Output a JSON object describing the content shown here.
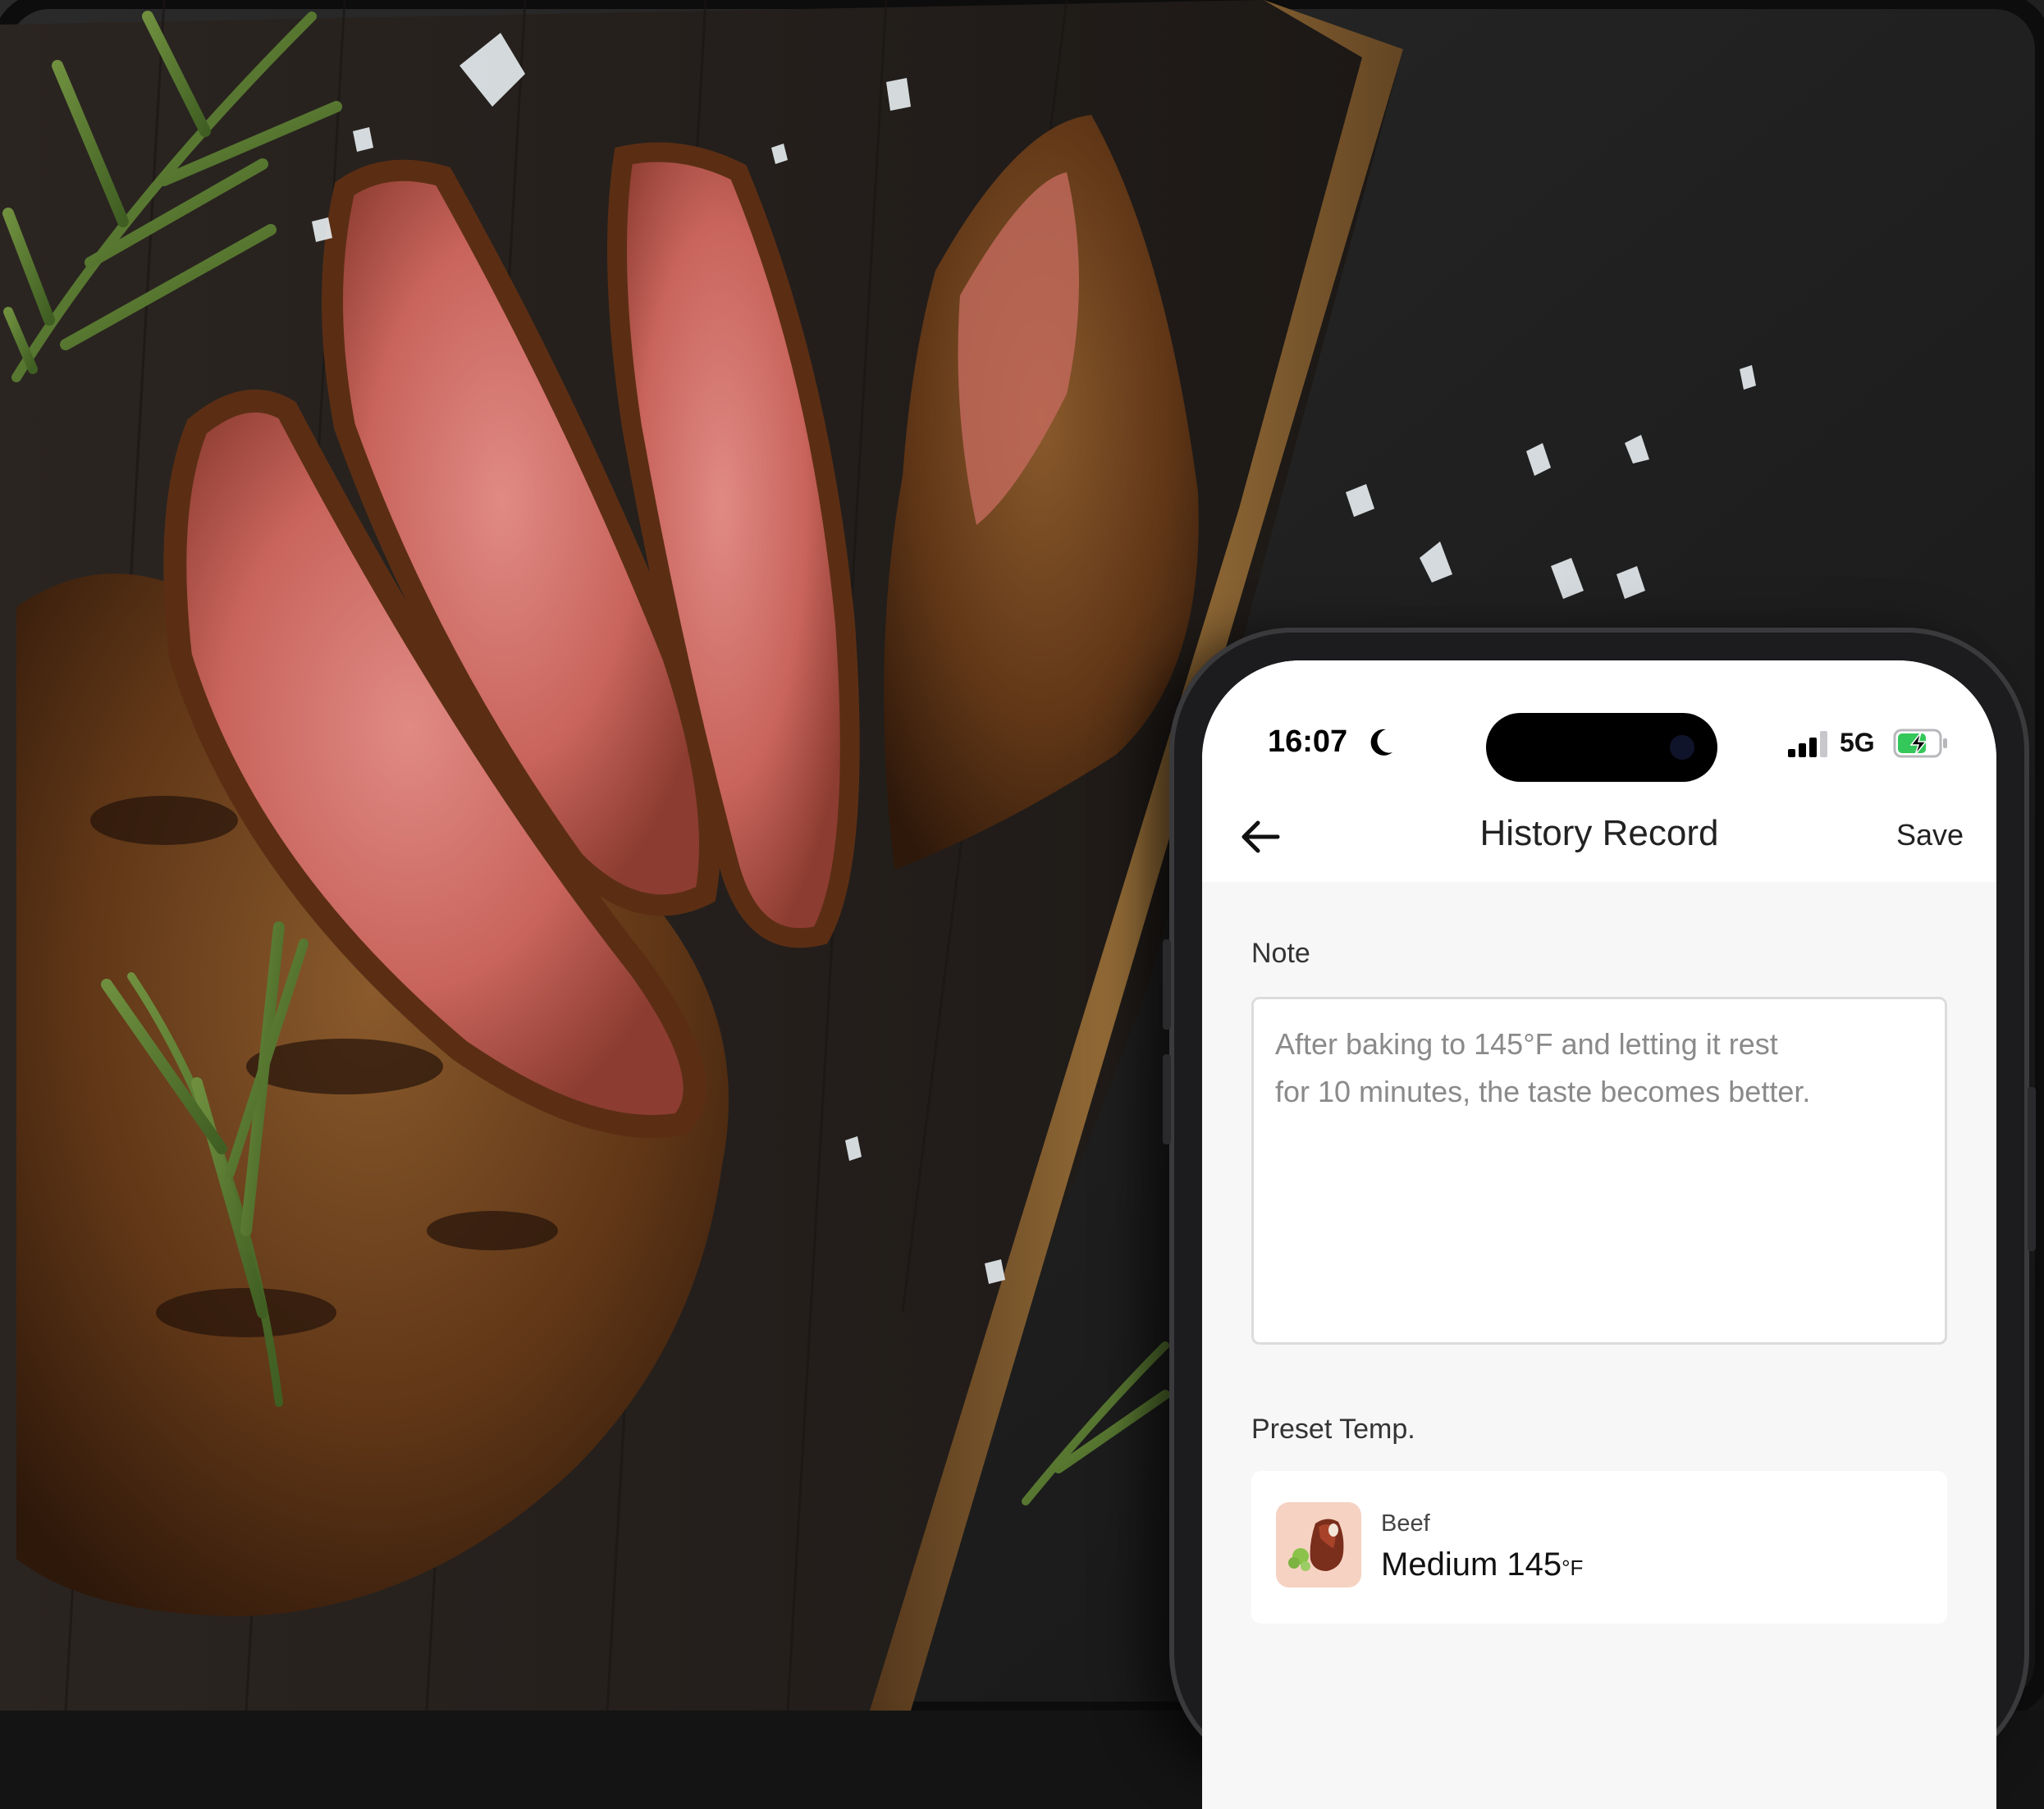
{
  "status_bar": {
    "time": "16:07",
    "network": "5G",
    "icons": [
      "moon-icon",
      "signal-icon",
      "battery-charging-icon"
    ]
  },
  "nav": {
    "title": "History Record",
    "save_label": "Save",
    "back_icon": "arrow-left-icon"
  },
  "note": {
    "label": "Note",
    "value_line1": "After baking to 145°F and letting it rest",
    "value_line2": "for 10 minutes, the taste becomes better."
  },
  "preset": {
    "label": "Preset Temp.",
    "category": "Beef",
    "doneness": "Medium",
    "temperature": "145",
    "unit": "°F",
    "icon": "beef-icon"
  },
  "colors": {
    "screen_background": "#f7f7f7",
    "card_background": "#ffffff",
    "thumb_background": "#f6d2c2",
    "battery_charging": "#34c759"
  }
}
